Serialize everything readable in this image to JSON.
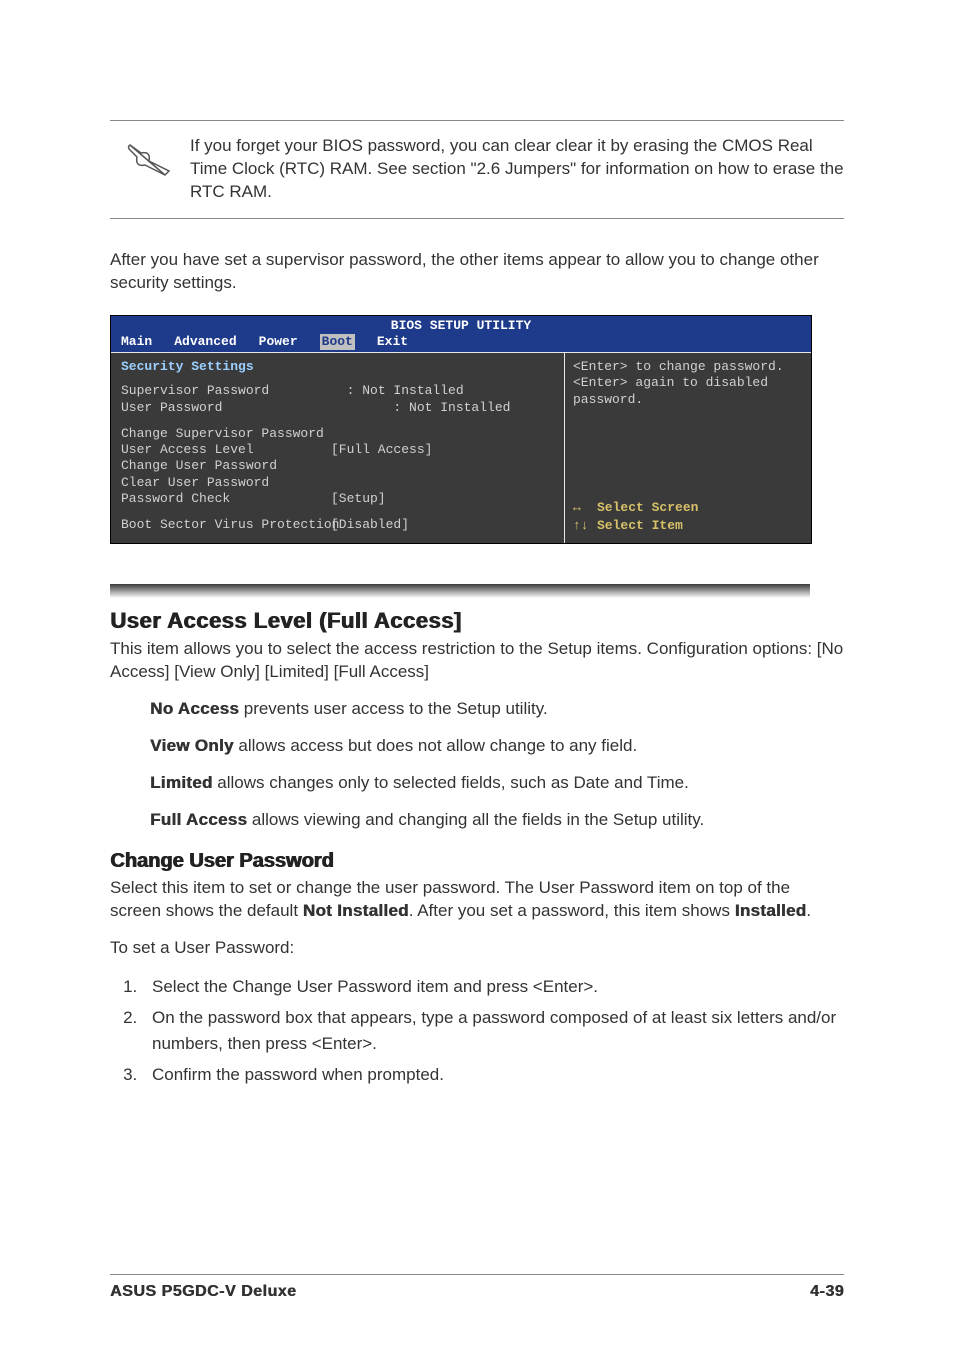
{
  "note": {
    "text": "If you forget your BIOS password, you can clear clear it by erasing the CMOS Real Time Clock (RTC) RAM. See section \"2.6  Jumpers\" for information on how to erase the RTC RAM."
  },
  "intro": "After you have set a supervisor password, the other items appear to allow you to change other security settings.",
  "bios": {
    "title": "BIOS SETUP UTILITY",
    "menu": [
      "Main",
      "Advanced",
      "Power",
      "Boot",
      "Exit"
    ],
    "selected_menu": "Boot",
    "left": {
      "section": "Security Settings",
      "rows": [
        {
          "label": "Supervisor Password",
          "sep": "  : ",
          "value": "Not Installed"
        },
        {
          "label": "User Password",
          "sep": "        : ",
          "value": "Not Installed"
        }
      ],
      "items": [
        {
          "label": "Change Supervisor Password",
          "value": ""
        },
        {
          "label": "User Access Level",
          "value": "[Full Access]"
        },
        {
          "label": "Change User Password",
          "value": ""
        },
        {
          "label": "Clear User Password",
          "value": ""
        },
        {
          "label": "Password Check",
          "value": "[Setup]"
        }
      ],
      "extra": {
        "label": "Boot Sector Virus Protection",
        "value": "[Disabled]"
      }
    },
    "right": {
      "help": "<Enter> to change password.\n<Enter> again to disabled password.",
      "nav": [
        {
          "arrow": "↔",
          "text": "Select Screen"
        },
        {
          "arrow": "↑↓",
          "text": "Select Item"
        }
      ]
    }
  },
  "sections": {
    "ual": {
      "heading": "User Access Level (Full Access]",
      "body": "This item allows you to select the access restriction to the Setup items. Configuration options: [No Access] [View Only] [Limited] [Full Access]",
      "options": [
        {
          "name": "No Access",
          "desc": " prevents user access to the Setup utility."
        },
        {
          "name": "View Only",
          "desc": " allows access but does not allow change to any field."
        },
        {
          "name": "Limited",
          "desc": " allows changes only to selected fields, such as Date and Time."
        },
        {
          "name": "Full Access",
          "desc": " allows viewing and changing all the fields in the Setup utility."
        }
      ]
    },
    "cup": {
      "heading": "Change User Password",
      "body_pre": "Select this item to set or change the user password. The User Password item on top of the screen shows the default ",
      "body_bold1": "Not Installed",
      "body_mid": ". After you set a password, this item shows ",
      "body_bold2": "Installed",
      "body_post": ".",
      "lead": "To set a User Password:",
      "steps": [
        "Select the Change User Password item and press <Enter>.",
        "On the password box that appears, type a password composed of at least six letters and/or numbers, then press <Enter>.",
        "Confirm the password when prompted."
      ]
    }
  },
  "footer": {
    "left": "ASUS P5GDC-V Deluxe",
    "right": "4-39"
  }
}
